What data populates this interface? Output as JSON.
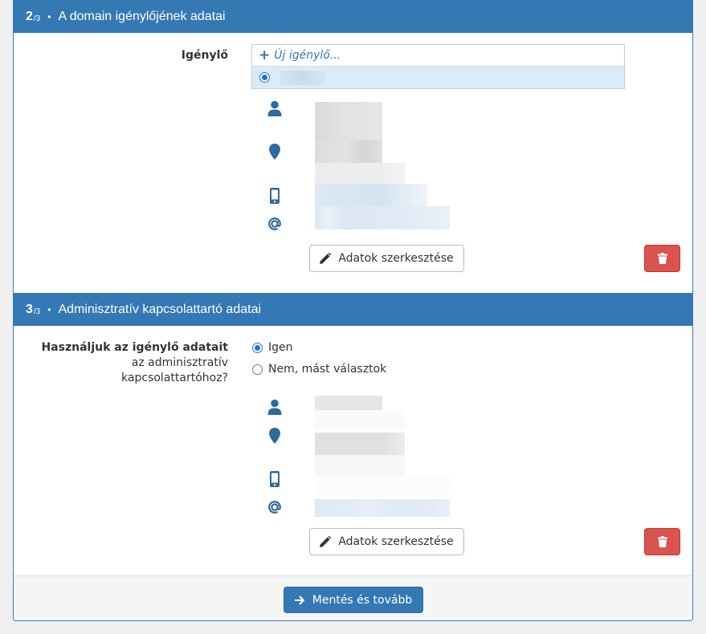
{
  "section2": {
    "step_num": "2",
    "step_den": "/3",
    "bullet": "•",
    "title": "A domain igénylőjének adatai",
    "requester_label": "Igénylő",
    "new_requester": "Új igénylő...",
    "new_requester_icon": "plus-icon",
    "edit_button": "Adatok szerkesztése",
    "icons": [
      "user-icon",
      "map-marker-icon",
      "mobile-icon",
      "at-icon",
      "pencil-icon",
      "trash-icon"
    ]
  },
  "section3": {
    "step_num": "3",
    "step_den": "/3",
    "bullet": "•",
    "title": "Adminisztratív kapcsolattartó adatai",
    "question_line1": "Használjuk az igénylő adatait",
    "question_line2": "az adminisztratív",
    "question_line3": "kapcsolattartóhoz?",
    "option_yes": "Igen",
    "option_no": "Nem, mást választok",
    "selected": "Igen",
    "edit_button": "Adatok szerkesztése"
  },
  "footer": {
    "save_button": "Mentés és tovább",
    "save_icon": "arrow-right-icon"
  },
  "colors": {
    "header_blue": "#3478b4",
    "selected_row": "#d9ecf7",
    "danger": "#d9534f",
    "icon_blue": "#2f6a9c"
  }
}
